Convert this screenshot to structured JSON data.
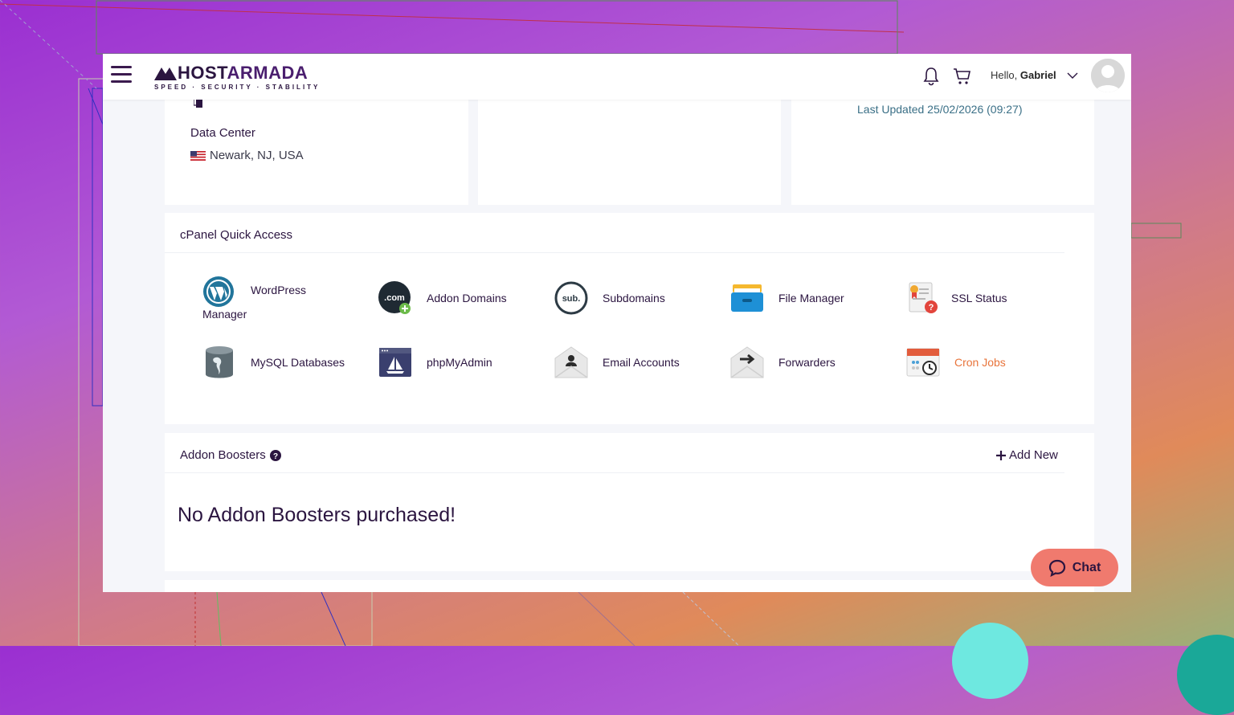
{
  "header": {
    "logo_text_a": "HOST",
    "logo_text_b": "ARMADA",
    "logo_tagline": "SPEED · SECURITY · STABILITY",
    "greeting": "Hello,",
    "user_name": "Gabriel"
  },
  "server_info": {
    "data_center_label": "Data Center",
    "data_center_value": "Newark, NJ, USA",
    "last_updated": "Last Updated 25/02/2026 (09:27)"
  },
  "cpanel": {
    "title": "cPanel Quick Access",
    "items": [
      {
        "label_line1": "WordPress",
        "label_line2": "Manager",
        "icon": "wordpress-icon"
      },
      {
        "label": "Addon Domains",
        "icon": "addon-domains-icon"
      },
      {
        "label": "Subdomains",
        "icon": "subdomains-icon"
      },
      {
        "label": "File Manager",
        "icon": "file-manager-icon"
      },
      {
        "label": "SSL Status",
        "icon": "ssl-status-icon"
      },
      {
        "label": "MySQL Databases",
        "icon": "mysql-icon"
      },
      {
        "label": "phpMyAdmin",
        "icon": "phpmyadmin-icon"
      },
      {
        "label": "Email Accounts",
        "icon": "email-accounts-icon"
      },
      {
        "label": "Forwarders",
        "icon": "forwarders-icon"
      },
      {
        "label": "Cron Jobs",
        "icon": "cron-jobs-icon"
      }
    ]
  },
  "addon_boosters": {
    "title": "Addon Boosters",
    "add_new": "Add New",
    "empty_message": "No Addon Boosters purchased!"
  },
  "chat": {
    "label": "Chat"
  },
  "colors": {
    "brand": "#2b1540",
    "accent_orange": "#e8743b",
    "link_teal": "#3a6f86",
    "chat_bg": "#f07a6e"
  }
}
